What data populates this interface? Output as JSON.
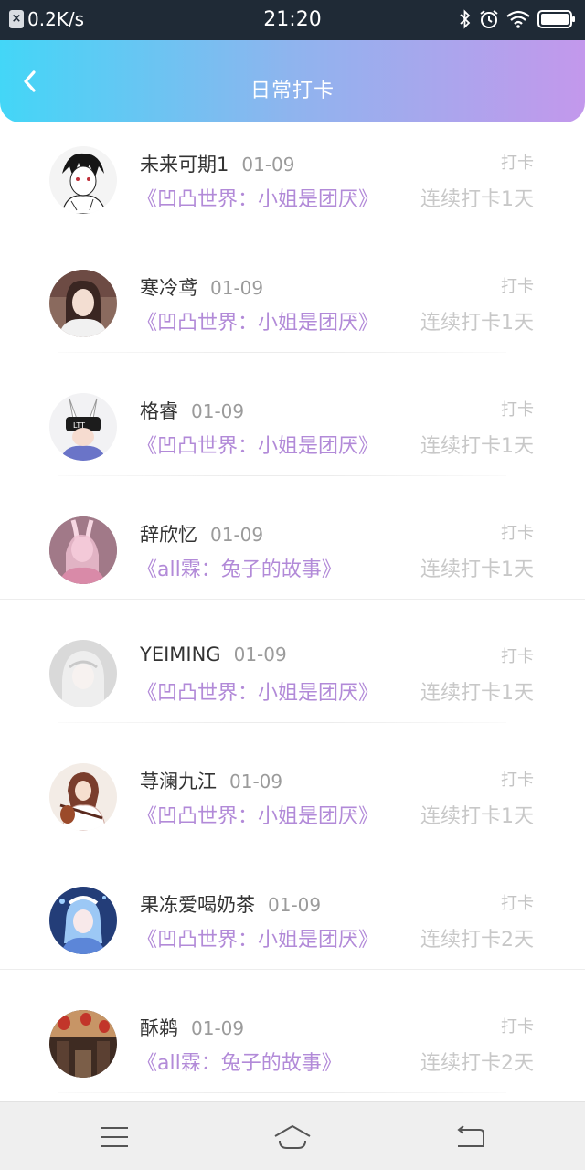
{
  "status_bar": {
    "network_speed": "0.2K/s",
    "time": "21:20",
    "icons": [
      "notification-x-icon",
      "bluetooth-icon",
      "alarm-icon",
      "wifi-icon",
      "battery-icon"
    ]
  },
  "header": {
    "title": "日常打卡",
    "back_icon": "chevron-left-icon",
    "gradient": [
      "#43d6f7",
      "#c398ec"
    ]
  },
  "checkins": [
    {
      "name": "未来可期1",
      "date": "01-09",
      "tag": "打卡",
      "book": "《凹凸世界：小姐是团厌》",
      "streak": "连续打卡1天"
    },
    {
      "name": "寒冷鸢",
      "date": "01-09",
      "tag": "打卡",
      "book": "《凹凸世界：小姐是团厌》",
      "streak": "连续打卡1天"
    },
    {
      "name": "格睿",
      "date": "01-09",
      "tag": "打卡",
      "book": "《凹凸世界：小姐是团厌》",
      "streak": "连续打卡1天"
    },
    {
      "name": "辞欣忆",
      "date": "01-09",
      "tag": "打卡",
      "book": "《all霖：兔子的故事》",
      "streak": "连续打卡1天"
    },
    {
      "name": "YEIMING",
      "date": "01-09",
      "tag": "打卡",
      "book": "《凹凸世界：小姐是团厌》",
      "streak": "连续打卡1天"
    },
    {
      "name": "荨澜九江",
      "date": "01-09",
      "tag": "打卡",
      "book": "《凹凸世界：小姐是团厌》",
      "streak": "连续打卡1天"
    },
    {
      "name": "果冻爱喝奶茶",
      "date": "01-09",
      "tag": "打卡",
      "book": "《凹凸世界：小姐是团厌》",
      "streak": "连续打卡2天"
    },
    {
      "name": "酥鹈",
      "date": "01-09",
      "tag": "打卡",
      "book": "《all霖：兔子的故事》",
      "streak": "连续打卡2天"
    }
  ],
  "colors": {
    "book_link": "#b28ad8",
    "muted": "#c8c8c8",
    "name": "#333333"
  },
  "nav_bar": {
    "icons": [
      "menu-icon",
      "home-icon",
      "back-icon"
    ]
  }
}
